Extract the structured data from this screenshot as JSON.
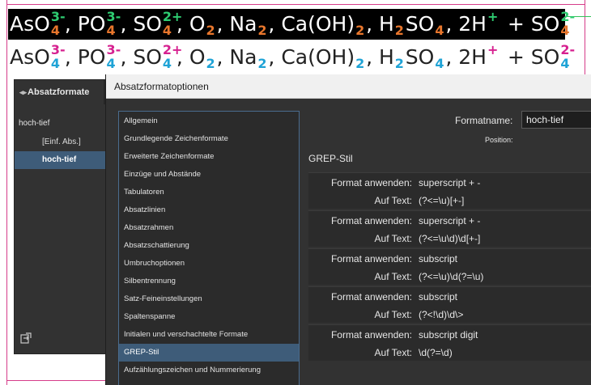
{
  "document": {
    "formula_lines": [
      {
        "parts": [
          {
            "text": "AsO",
            "sup": "3-",
            "sub": "4"
          },
          {
            "text": ", PO",
            "sup": "3-",
            "sub": "4"
          },
          {
            "text": ", SO",
            "sup": "2+",
            "sub": "4"
          },
          {
            "text": ", O",
            "sub": "2"
          },
          {
            "text": ", Na",
            "sub": "2"
          },
          {
            "text": ", Ca(OH)",
            "sub": "2"
          },
          {
            "text": ", H",
            "sub": "2"
          },
          {
            "text": "SO",
            "sub": "4"
          },
          {
            "text": ", 2H",
            "sup": "+"
          },
          {
            "text": " + SO",
            "sup": "2-",
            "sub": "4"
          }
        ],
        "colors": {
          "sup": "#2ecc71",
          "sub": "#e8762c"
        }
      },
      {
        "parts": [
          {
            "text": "AsO",
            "sup": "3-",
            "sub": "4"
          },
          {
            "text": ", PO",
            "sup": "3-",
            "sub": "4"
          },
          {
            "text": ", SO",
            "sup": "2+",
            "sub": "4"
          },
          {
            "text": ", O",
            "sub": "2"
          },
          {
            "text": ", Na",
            "sub": "2"
          },
          {
            "text": ", Ca(OH)",
            "sub": "2"
          },
          {
            "text": ", H",
            "sub": "2"
          },
          {
            "text": "SO",
            "sub": "4"
          },
          {
            "text": ", 2H",
            "sup": "+"
          },
          {
            "text": " + SO",
            "sup": "2-",
            "sub": "4"
          }
        ],
        "colors": {
          "sup": "#d6208f",
          "sub": "#1fa3d6"
        }
      }
    ]
  },
  "styles_panel": {
    "tab_label": "Absatzformate",
    "current_style": "hoch-tief",
    "items": [
      {
        "label": "[Einf. Abs.]",
        "selected": false
      },
      {
        "label": "hoch-tief",
        "selected": true
      }
    ],
    "footer_icon": "load-styles-icon"
  },
  "dialog": {
    "title": "Absatzformatoptionen",
    "categories": [
      {
        "label": "Allgemein",
        "selected": false
      },
      {
        "label": "Grundlegende Zeichenformate",
        "selected": false
      },
      {
        "label": "Erweiterte Zeichenformate",
        "selected": false
      },
      {
        "label": "Einzüge und Abstände",
        "selected": false
      },
      {
        "label": "Tabulatoren",
        "selected": false
      },
      {
        "label": "Absatzlinien",
        "selected": false
      },
      {
        "label": "Absatzrahmen",
        "selected": false
      },
      {
        "label": "Absatzschattierung",
        "selected": false
      },
      {
        "label": "Umbruchoptionen",
        "selected": false
      },
      {
        "label": "Silbentrennung",
        "selected": false
      },
      {
        "label": "Satz-Feineinstellungen",
        "selected": false
      },
      {
        "label": "Spaltenspanne",
        "selected": false
      },
      {
        "label": "Initialen und verschachtelte Formate",
        "selected": false
      },
      {
        "label": "GREP-Stil",
        "selected": true
      },
      {
        "label": "Aufzählungszeichen und Nummerierung",
        "selected": false
      }
    ],
    "format_name_label": "Formatname:",
    "format_name_value": "hoch-tief",
    "position_label": "Position:",
    "section_title": "GREP-Stil",
    "apply_label": "Format anwenden:",
    "text_label": "Auf Text:",
    "rules": [
      {
        "style": "superscript + -",
        "pattern": "(?<=\\u)[+-]"
      },
      {
        "style": "superscript + -",
        "pattern": "(?<=\\u\\d)\\d[+-]"
      },
      {
        "style": "subscript",
        "pattern": "(?<=\\u)\\d(?=\\u)"
      },
      {
        "style": "subscript",
        "pattern": "(?<!\\d)\\d\\>"
      },
      {
        "style": "subscript digit",
        "pattern": "\\d(?=\\d)"
      }
    ]
  }
}
